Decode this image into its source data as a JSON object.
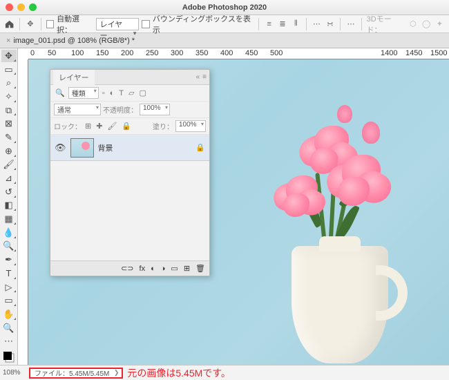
{
  "app_title": "Adobe Photoshop 2020",
  "options_bar": {
    "auto_select_label": "自動選択：",
    "auto_select_target": "レイヤー",
    "show_bbox_label": "バウンディングボックスを表示",
    "mode3d_label": "3Dモード："
  },
  "document_tab": {
    "label": "image_001.psd @ 108% (RGB/8*) *"
  },
  "ruler_marks": [
    "0",
    "50",
    "100",
    "150",
    "200",
    "250",
    "300",
    "350",
    "400",
    "450",
    "500",
    "1400",
    "1450",
    "1500"
  ],
  "layers_panel": {
    "title": "レイヤー",
    "filter_placeholder": "種類",
    "blend_mode": "通常",
    "opacity_label": "不透明度：",
    "opacity_value": "100%",
    "lock_label": "ロック：",
    "fill_label": "塗り：",
    "fill_value": "100%",
    "layers": [
      {
        "name": "背景",
        "visible": true,
        "locked": true
      }
    ],
    "footer": {
      "link": "⊂⊃",
      "fx": "fx",
      "mask": "◐",
      "adjust": "◑",
      "group": "▭",
      "new": "⊞",
      "trash": "🗑"
    }
  },
  "status_bar": {
    "zoom": "108%",
    "file_info": "ファイル：5.45M/5.45M"
  },
  "annotation": "元の画像は5.45Mです。",
  "colors": {
    "highlight": "#e8252f"
  }
}
